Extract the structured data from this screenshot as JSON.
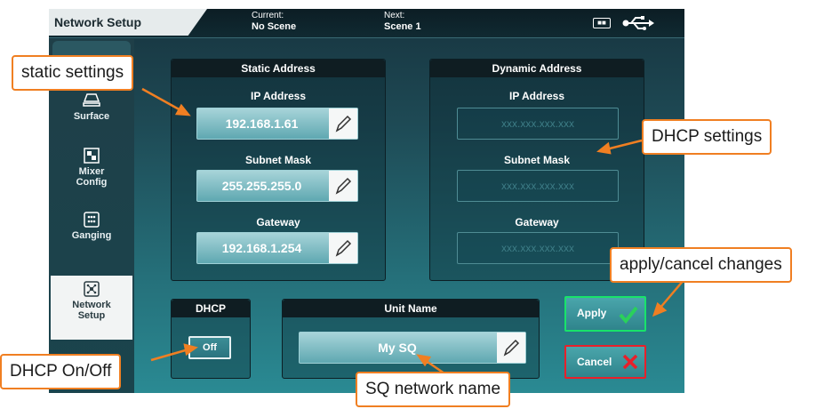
{
  "header": {
    "title": "Network Setup",
    "current_label": "Current:",
    "current_value": "No Scene",
    "next_label": "Next:",
    "next_value": "Scene 1",
    "ram_icon_text": "■■"
  },
  "sidebar": {
    "items": [
      {
        "label": "Surface",
        "icon": "surface-icon"
      },
      {
        "label": "Mixer Config",
        "icon": "mixer-config-icon"
      },
      {
        "label": "Ganging",
        "icon": "ganging-icon"
      },
      {
        "label": "Network Setup",
        "icon": "network-icon",
        "active": true
      }
    ]
  },
  "static_address": {
    "title": "Static Address",
    "ip_label": "IP Address",
    "ip_value": "192.168.1.61",
    "subnet_label": "Subnet Mask",
    "subnet_value": "255.255.255.0",
    "gateway_label": "Gateway",
    "gateway_value": "192.168.1.254"
  },
  "dynamic_address": {
    "title": "Dynamic Address",
    "ip_label": "IP Address",
    "ip_value": "xxx.xxx.xxx.xxx",
    "subnet_label": "Subnet Mask",
    "subnet_value": "xxx.xxx.xxx.xxx",
    "gateway_label": "Gateway",
    "gateway_value": "xxx.xxx.xxx.xxx"
  },
  "dhcp": {
    "title": "DHCP",
    "button_label": "Off"
  },
  "unit_name": {
    "title": "Unit Name",
    "value": "My SQ"
  },
  "actions": {
    "apply_label": "Apply",
    "cancel_label": "Cancel"
  },
  "callouts": {
    "static": "static settings",
    "dhcp_settings": "DHCP settings",
    "apply": "apply/cancel changes",
    "dhcp_toggle": "DHCP On/Off",
    "network_name": "SQ network name"
  },
  "colors": {
    "callout_border": "#f07f22",
    "apply_border": "#18e36a",
    "cancel_border": "#e8202a",
    "check": "#2ad15a",
    "cross": "#e8202a"
  }
}
